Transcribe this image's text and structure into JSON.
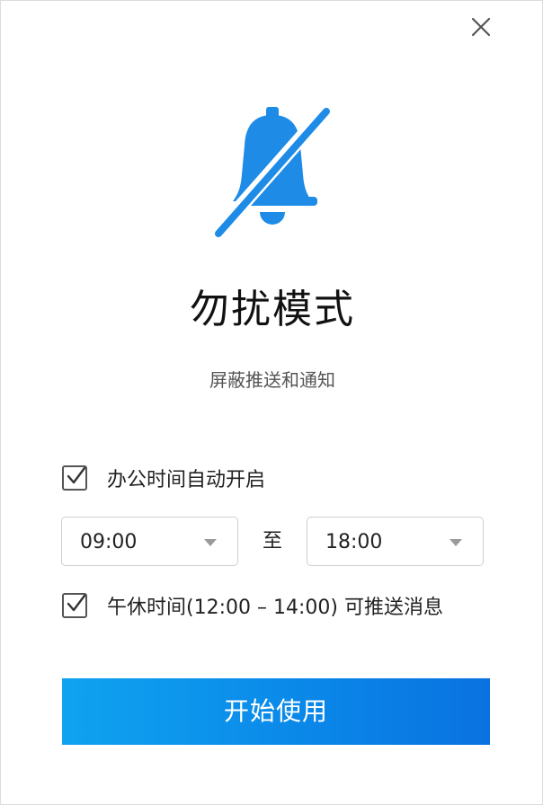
{
  "dialog": {
    "title": "勿扰模式",
    "subtitle": "屏蔽推送和通知",
    "icons": {
      "close": "close-icon",
      "hero": "bell-slash-icon",
      "check": "check-icon",
      "dropdown": "caret-down-icon"
    },
    "colors": {
      "accent": "#1e8be6",
      "button_start": "#0fa3f0",
      "button_end": "#0a72e0"
    }
  },
  "office_hours": {
    "label": "办公时间自动开启",
    "checked": true,
    "start_time": "09:00",
    "separator": "至",
    "end_time": "18:00"
  },
  "lunch_break": {
    "label": "午休时间(12:00 – 14:00) 可推送消息",
    "checked": true
  },
  "actions": {
    "start_label": "开始使用"
  }
}
